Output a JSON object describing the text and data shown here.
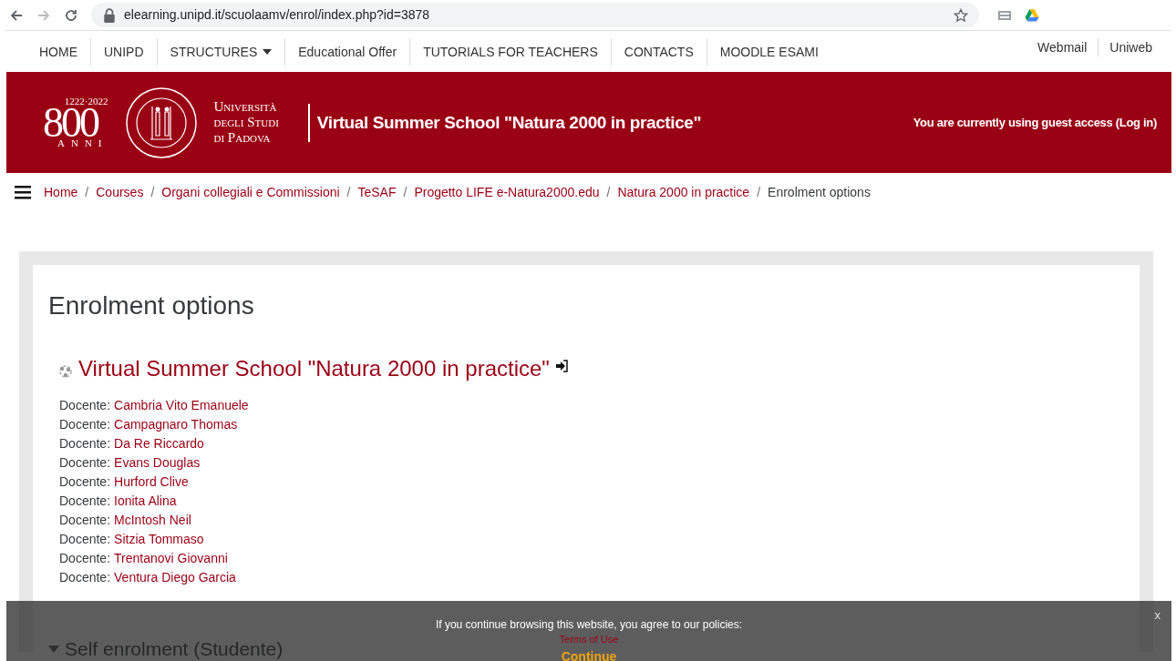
{
  "browser": {
    "url": "elearning.unipd.it/scuolaamv/enrol/index.php?id=3878"
  },
  "top_nav": {
    "items": [
      {
        "label": "HOME",
        "dropdown": false
      },
      {
        "label": "UNIPD",
        "dropdown": false
      },
      {
        "label": "STRUCTURES",
        "dropdown": true
      },
      {
        "label": "Educational Offer",
        "dropdown": false
      },
      {
        "label": "TUTORIALS FOR TEACHERS",
        "dropdown": false
      },
      {
        "label": "CONTACTS",
        "dropdown": false
      },
      {
        "label": "MOODLE ESAMI",
        "dropdown": false
      }
    ],
    "right_links": [
      "Webmail",
      "Uniweb"
    ]
  },
  "header": {
    "logo": {
      "years": "1222·2022",
      "number": "800",
      "word": "ANNI",
      "university": [
        "Università",
        "degli Studi",
        "di Padova"
      ]
    },
    "title": "Virtual Summer School \"Natura 2000 in practice\"",
    "guest_notice": "You are currently using guest access (Log in)"
  },
  "breadcrumb": [
    {
      "label": "Home",
      "link": true
    },
    {
      "separator": "/",
      "label": "Courses",
      "link": true
    },
    {
      "separator": "/",
      "label": "Organi collegiali e Commissioni",
      "link": true
    },
    {
      "separator": "/",
      "label": "TeSAF",
      "link": true
    },
    {
      "separator": "/",
      "label": "Progetto LIFE e-Natura2000.edu",
      "link": true
    },
    {
      "separator": "/",
      "label": "Natura 2000 in practice",
      "link": true
    },
    {
      "separator": "/",
      "label": "Enrolment options",
      "link": false
    }
  ],
  "page": {
    "heading": "Enrolment options",
    "course_title": "Virtual Summer School \"Natura 2000 in practice\"",
    "teachers": [
      {
        "role": "Docente:",
        "name": "Cambria Vito Emanuele"
      },
      {
        "role": "Docente:",
        "name": "Campagnaro Thomas"
      },
      {
        "role": "Docente:",
        "name": "Da Re Riccardo"
      },
      {
        "role": "Docente:",
        "name": "Evans Douglas"
      },
      {
        "role": "Docente:",
        "name": "Hurford Clive"
      },
      {
        "role": "Docente:",
        "name": "Ionita Alina"
      },
      {
        "role": "Docente:",
        "name": "McIntosh Neil"
      },
      {
        "role": "Docente:",
        "name": "Sitzia Tommaso"
      },
      {
        "role": "Docente:",
        "name": "Trentanovi Giovanni"
      },
      {
        "role": "Docente:",
        "name": "Ventura Diego Garcia"
      }
    ],
    "section_title": "Self enrolment (Studente)"
  },
  "policy_banner": {
    "message": "If you continue browsing this website, you agree to our policies:",
    "link": "Terms of Use",
    "button": "Continue",
    "close": "x"
  }
}
